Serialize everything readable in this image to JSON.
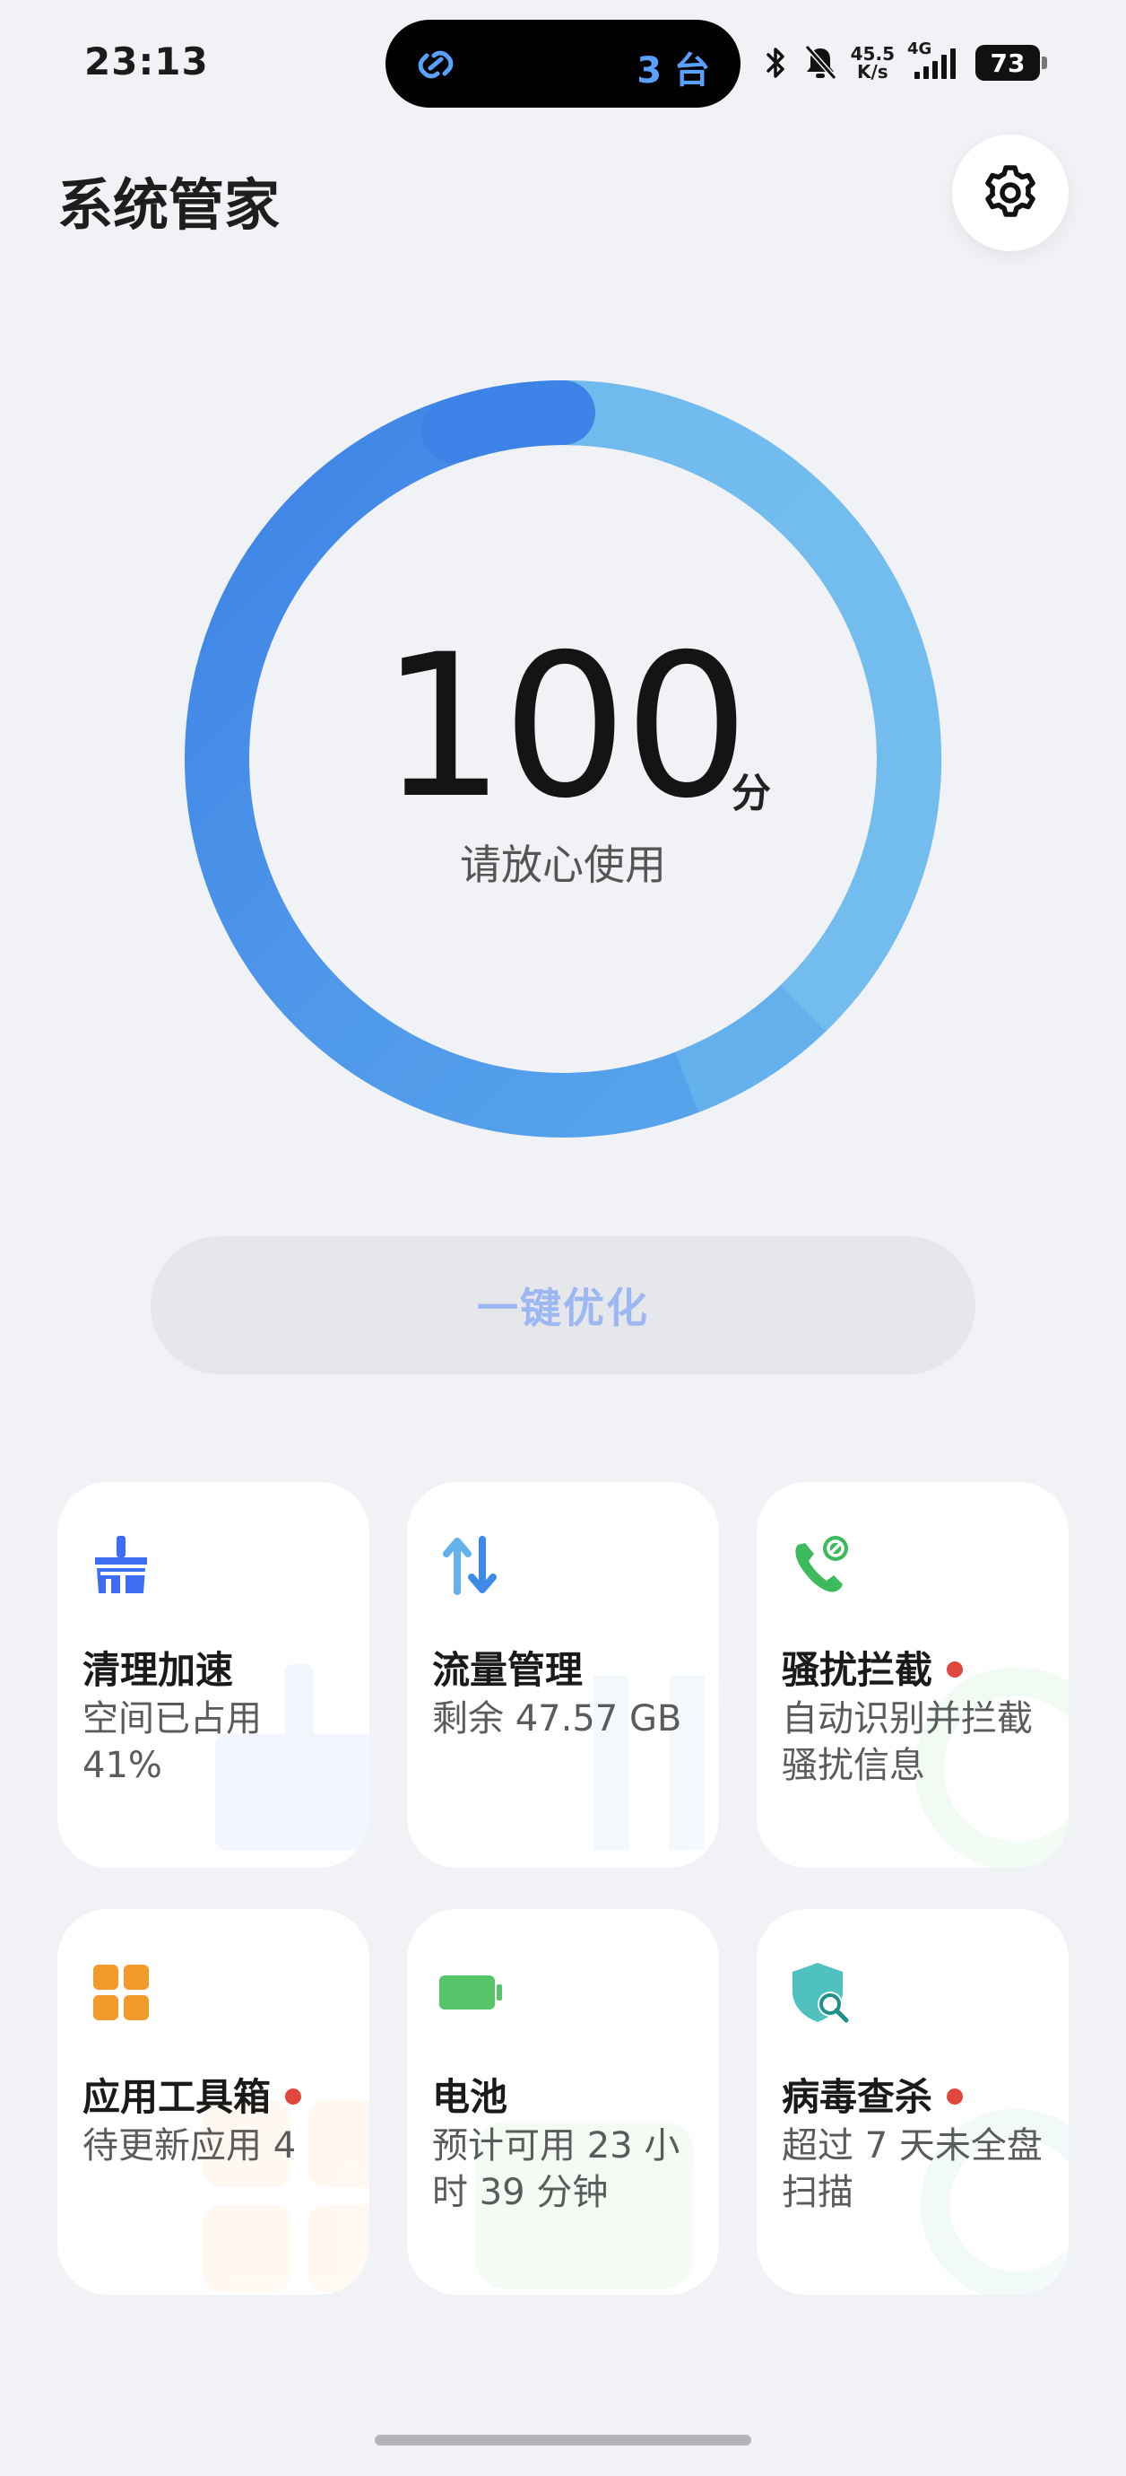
{
  "status_bar": {
    "time": "23:13",
    "devices": "3 台",
    "speed_value": "45.5",
    "speed_unit": "K/s",
    "network": "4G",
    "battery": "73"
  },
  "header": {
    "title": "系统管家"
  },
  "score": {
    "value": "100",
    "unit": "分",
    "status": "请放心使用"
  },
  "optimize": {
    "label": "一键优化"
  },
  "tiles": [
    {
      "title": "清理加速",
      "subtitle": "空间已占用 41%",
      "badge": false,
      "icon": "broom-icon",
      "color": "#3d6df0"
    },
    {
      "title": "流量管理",
      "subtitle": "剩余 47.57 GB",
      "badge": false,
      "icon": "data-arrows-icon",
      "color": "#3f9be8"
    },
    {
      "title": "骚扰拦截",
      "subtitle": "自动识别并拦截骚扰信息",
      "badge": true,
      "icon": "phone-block-icon",
      "color": "#3dbb5c"
    },
    {
      "title": "应用工具箱",
      "subtitle": "待更新应用 4",
      "badge": true,
      "icon": "grid-apps-icon",
      "color": "#f39a2c"
    },
    {
      "title": "电池",
      "subtitle": "预计可用 23 小时 39 分钟",
      "badge": false,
      "icon": "battery-icon",
      "color": "#57c46a"
    },
    {
      "title": "病毒查杀",
      "subtitle": "超过 7 天未全盘扫描",
      "badge": true,
      "icon": "shield-scan-icon",
      "color": "#38a9a6"
    }
  ],
  "colors": {
    "ring_dark": "#3d82e6",
    "ring_light": "#78c2ee",
    "badge": "#e0473d",
    "button_text": "#9db7f2"
  }
}
